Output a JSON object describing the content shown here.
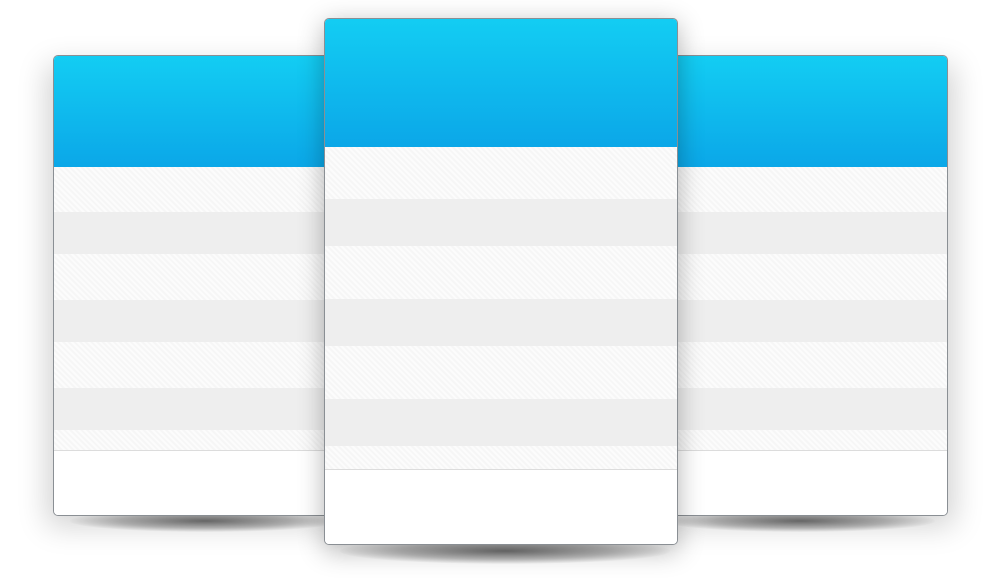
{
  "colors": {
    "header_top": "#13cdf3",
    "header_bottom": "#0ba7e8",
    "row_dark": "#eeeeee",
    "row_light": "#f9f9f9",
    "card_border": "#8a8f94"
  },
  "cards": [
    {
      "id": "left",
      "header_text": "",
      "rows": 7,
      "footer_text": ""
    },
    {
      "id": "center",
      "header_text": "",
      "rows": 7,
      "footer_text": ""
    },
    {
      "id": "right",
      "header_text": "",
      "rows": 7,
      "footer_text": ""
    }
  ]
}
